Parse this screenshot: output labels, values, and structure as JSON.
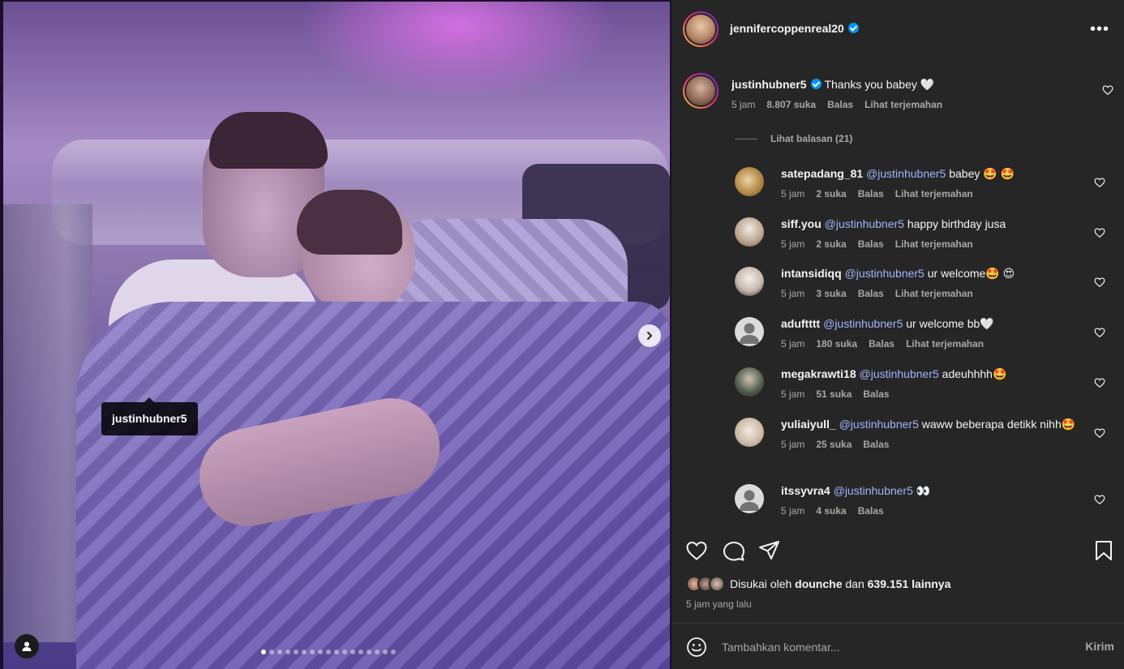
{
  "post": {
    "author": "jennifercoppenreal20",
    "photo_tag": "justinhubner5",
    "carousel": {
      "total": 17,
      "current": 1
    }
  },
  "caption_comment": {
    "user": "justinhubner5",
    "text": "Thanks you babey 🤍",
    "time": "5 jam",
    "likes": "8.807 suka",
    "reply": "Balas",
    "translate": "Lihat terjemahan"
  },
  "view_replies": "Lihat balasan (21)",
  "replies": [
    {
      "user": "satepadang_81",
      "mention": "@justinhubner5",
      "text": "babey 🤩 🤩",
      "time": "5 jam",
      "likes": "2 suka",
      "reply": "Balas",
      "translate": "Lihat terjemahan"
    },
    {
      "user": "siff.you",
      "mention": "@justinhubner5",
      "text": "happy birthday jusa",
      "time": "5 jam",
      "likes": "2 suka",
      "reply": "Balas",
      "translate": "Lihat terjemahan"
    },
    {
      "user": "intansidiqq",
      "mention": "@justinhubner5",
      "text": "ur welcome🤩 😍",
      "time": "5 jam",
      "likes": "3 suka",
      "reply": "Balas",
      "translate": "Lihat terjemahan"
    },
    {
      "user": "aduftttt",
      "mention": "@justinhubner5",
      "text": "ur welcome bb🤍",
      "time": "5 jam",
      "likes": "180 suka",
      "reply": "Balas",
      "translate": "Lihat terjemahan"
    },
    {
      "user": "megakrawti18",
      "mention": "@justinhubner5",
      "text": "adeuhhhh🤩",
      "time": "5 jam",
      "likes": "51 suka",
      "reply": "Balas",
      "translate": ""
    },
    {
      "user": "yuliaiyull_",
      "mention": "@justinhubner5",
      "text": "waww beberapa detikk nihh🤩",
      "time": "5 jam",
      "likes": "25 suka",
      "reply": "Balas",
      "translate": ""
    },
    {
      "user": "itssyvra4",
      "mention": "@justinhubner5",
      "text": "👀",
      "time": "5 jam",
      "likes": "4 suka",
      "reply": "Balas",
      "translate": ""
    }
  ],
  "likes_summary": {
    "prefix": "Disukai oleh",
    "user": "dounche",
    "joiner": "dan",
    "others": "639.151 lainnya"
  },
  "posted_ago": "5 jam yang lalu",
  "comment_box": {
    "placeholder": "Tambahkan komentar...",
    "post_label": "Kirim"
  },
  "icons": {
    "like": "heart-icon",
    "comment": "comment-icon",
    "share": "paper-plane-icon",
    "save": "bookmark-icon",
    "more": "more-icon",
    "emoji": "emoji-icon",
    "next": "chevron-right-icon",
    "tags": "user-tag-icon"
  },
  "colors": {
    "panel_bg": "#262626",
    "mention": "#a0b6ff",
    "verified": "#0095f6",
    "muted": "#a8a8a8"
  }
}
